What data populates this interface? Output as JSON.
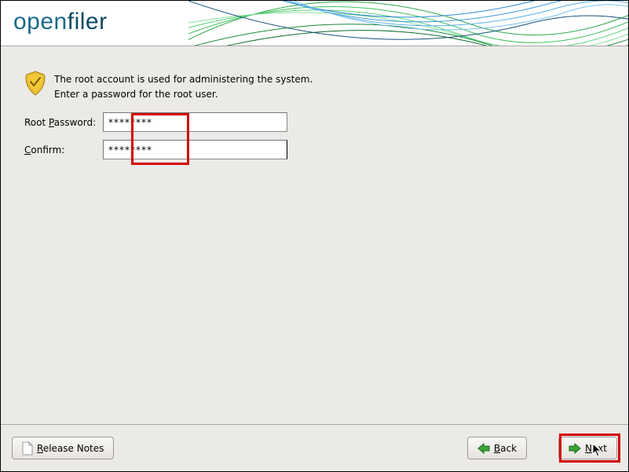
{
  "brand": {
    "open": "open",
    "filer": "filer"
  },
  "intro": {
    "line1": "The root account is used for administering the system.",
    "line2": "Enter a password for the root user."
  },
  "form": {
    "root_password_label_pre": "Root ",
    "root_password_accel": "P",
    "root_password_label_post": "assword:",
    "confirm_accel": "C",
    "confirm_label_post": "onfirm:",
    "root_password_value": "********",
    "confirm_value": "********"
  },
  "footer": {
    "release_notes_accel": "R",
    "release_notes_post": "elease Notes",
    "back_accel": "B",
    "back_post": "ack",
    "next_accel": "N",
    "next_post": "ext"
  }
}
